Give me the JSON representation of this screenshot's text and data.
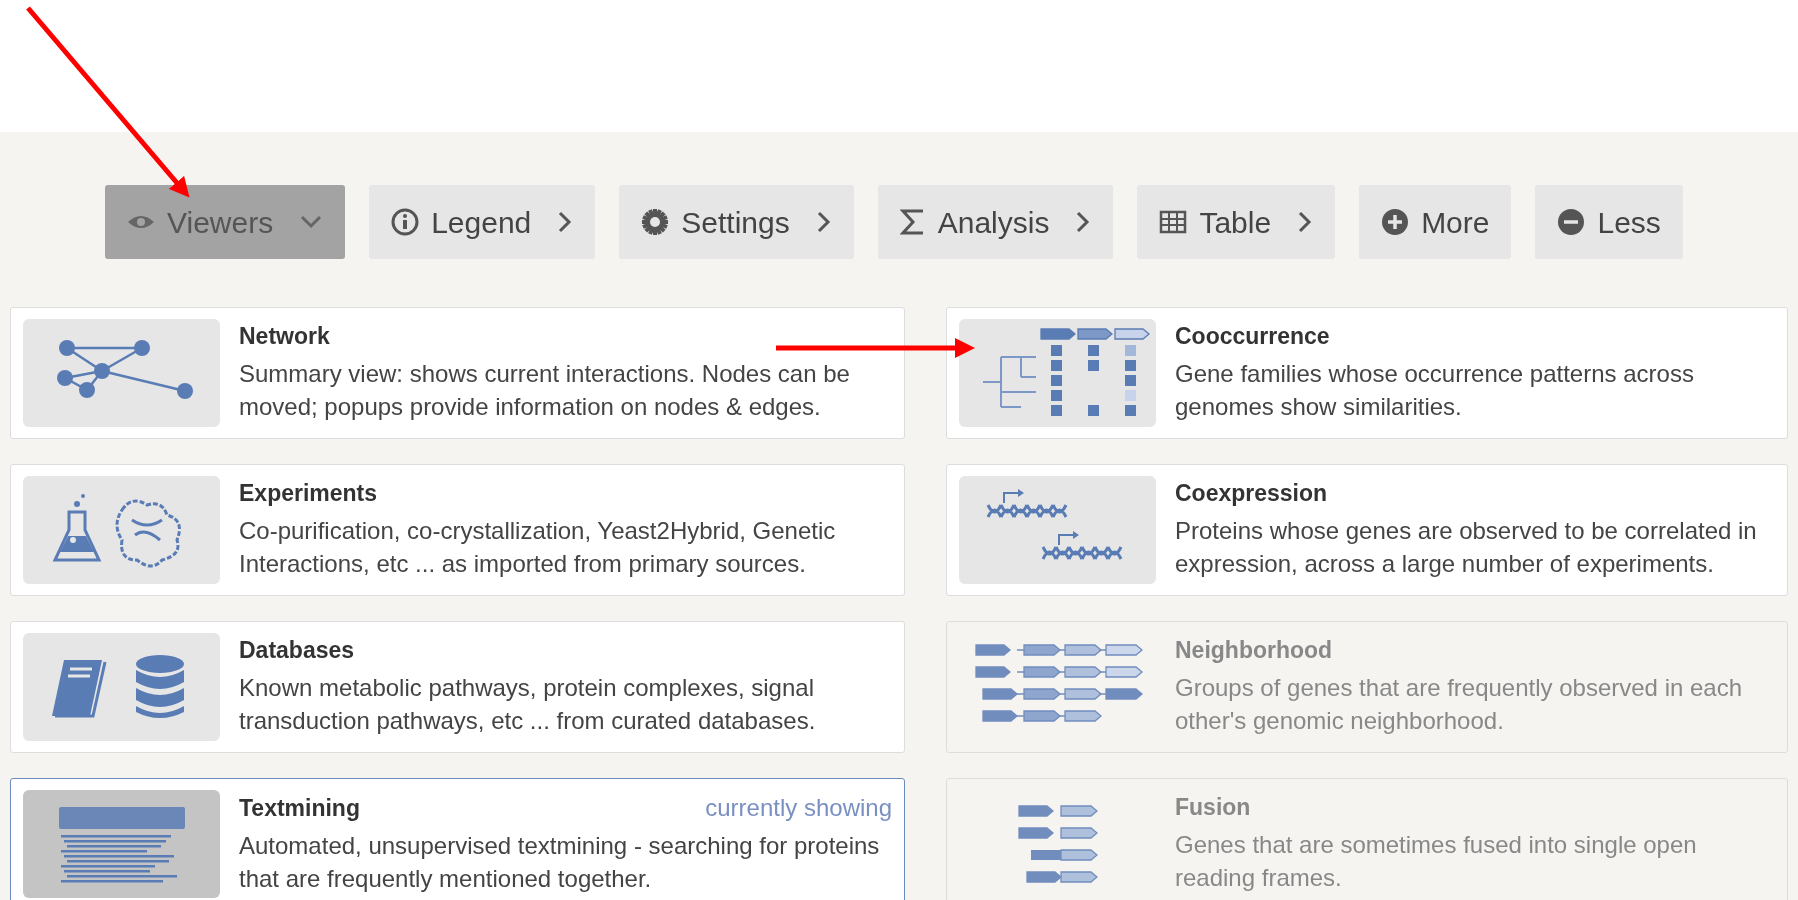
{
  "toolbar": [
    {
      "label": "Viewers",
      "kind": "dropdown",
      "selected": true
    },
    {
      "label": "Legend",
      "kind": "submenu",
      "selected": false
    },
    {
      "label": "Settings",
      "kind": "submenu",
      "selected": false
    },
    {
      "label": "Analysis",
      "kind": "submenu",
      "selected": false
    },
    {
      "label": "Table",
      "kind": "submenu",
      "selected": false
    },
    {
      "label": "More",
      "kind": "action",
      "selected": false
    },
    {
      "label": "Less",
      "kind": "action",
      "selected": false
    }
  ],
  "viewers": [
    {
      "title": "Network",
      "description": "Summary view: shows current interactions. Nodes can be moved; popups provide information on nodes & edges.",
      "enabled": true,
      "selected": false
    },
    {
      "title": "Cooccurrence",
      "description": "Gene families whose occurrence patterns across genomes show similarities.",
      "enabled": true,
      "selected": false
    },
    {
      "title": "Experiments",
      "description": "Co-purification, co-crystallization, Yeast2Hybrid, Genetic Interactions, etc ... as imported from primary sources.",
      "enabled": true,
      "selected": false
    },
    {
      "title": "Coexpression",
      "description": "Proteins whose genes are observed to be correlated in expression, across a large number of experiments.",
      "enabled": true,
      "selected": false
    },
    {
      "title": "Databases",
      "description": "Known metabolic pathways, protein complexes, signal transduction pathways, etc ... from curated databases.",
      "enabled": true,
      "selected": false
    },
    {
      "title": "Neighborhood",
      "description": "Groups of genes that are frequently observed in each other's genomic neighborhood.",
      "enabled": false,
      "selected": false
    },
    {
      "title": "Textmining",
      "description": "Automated, unsupervised textmining - searching for proteins that are frequently mentioned together.",
      "enabled": true,
      "selected": true,
      "status": "currently showing"
    },
    {
      "title": "Fusion",
      "description": "Genes that are sometimes fused into single open reading frames.",
      "enabled": false,
      "selected": false
    }
  ]
}
